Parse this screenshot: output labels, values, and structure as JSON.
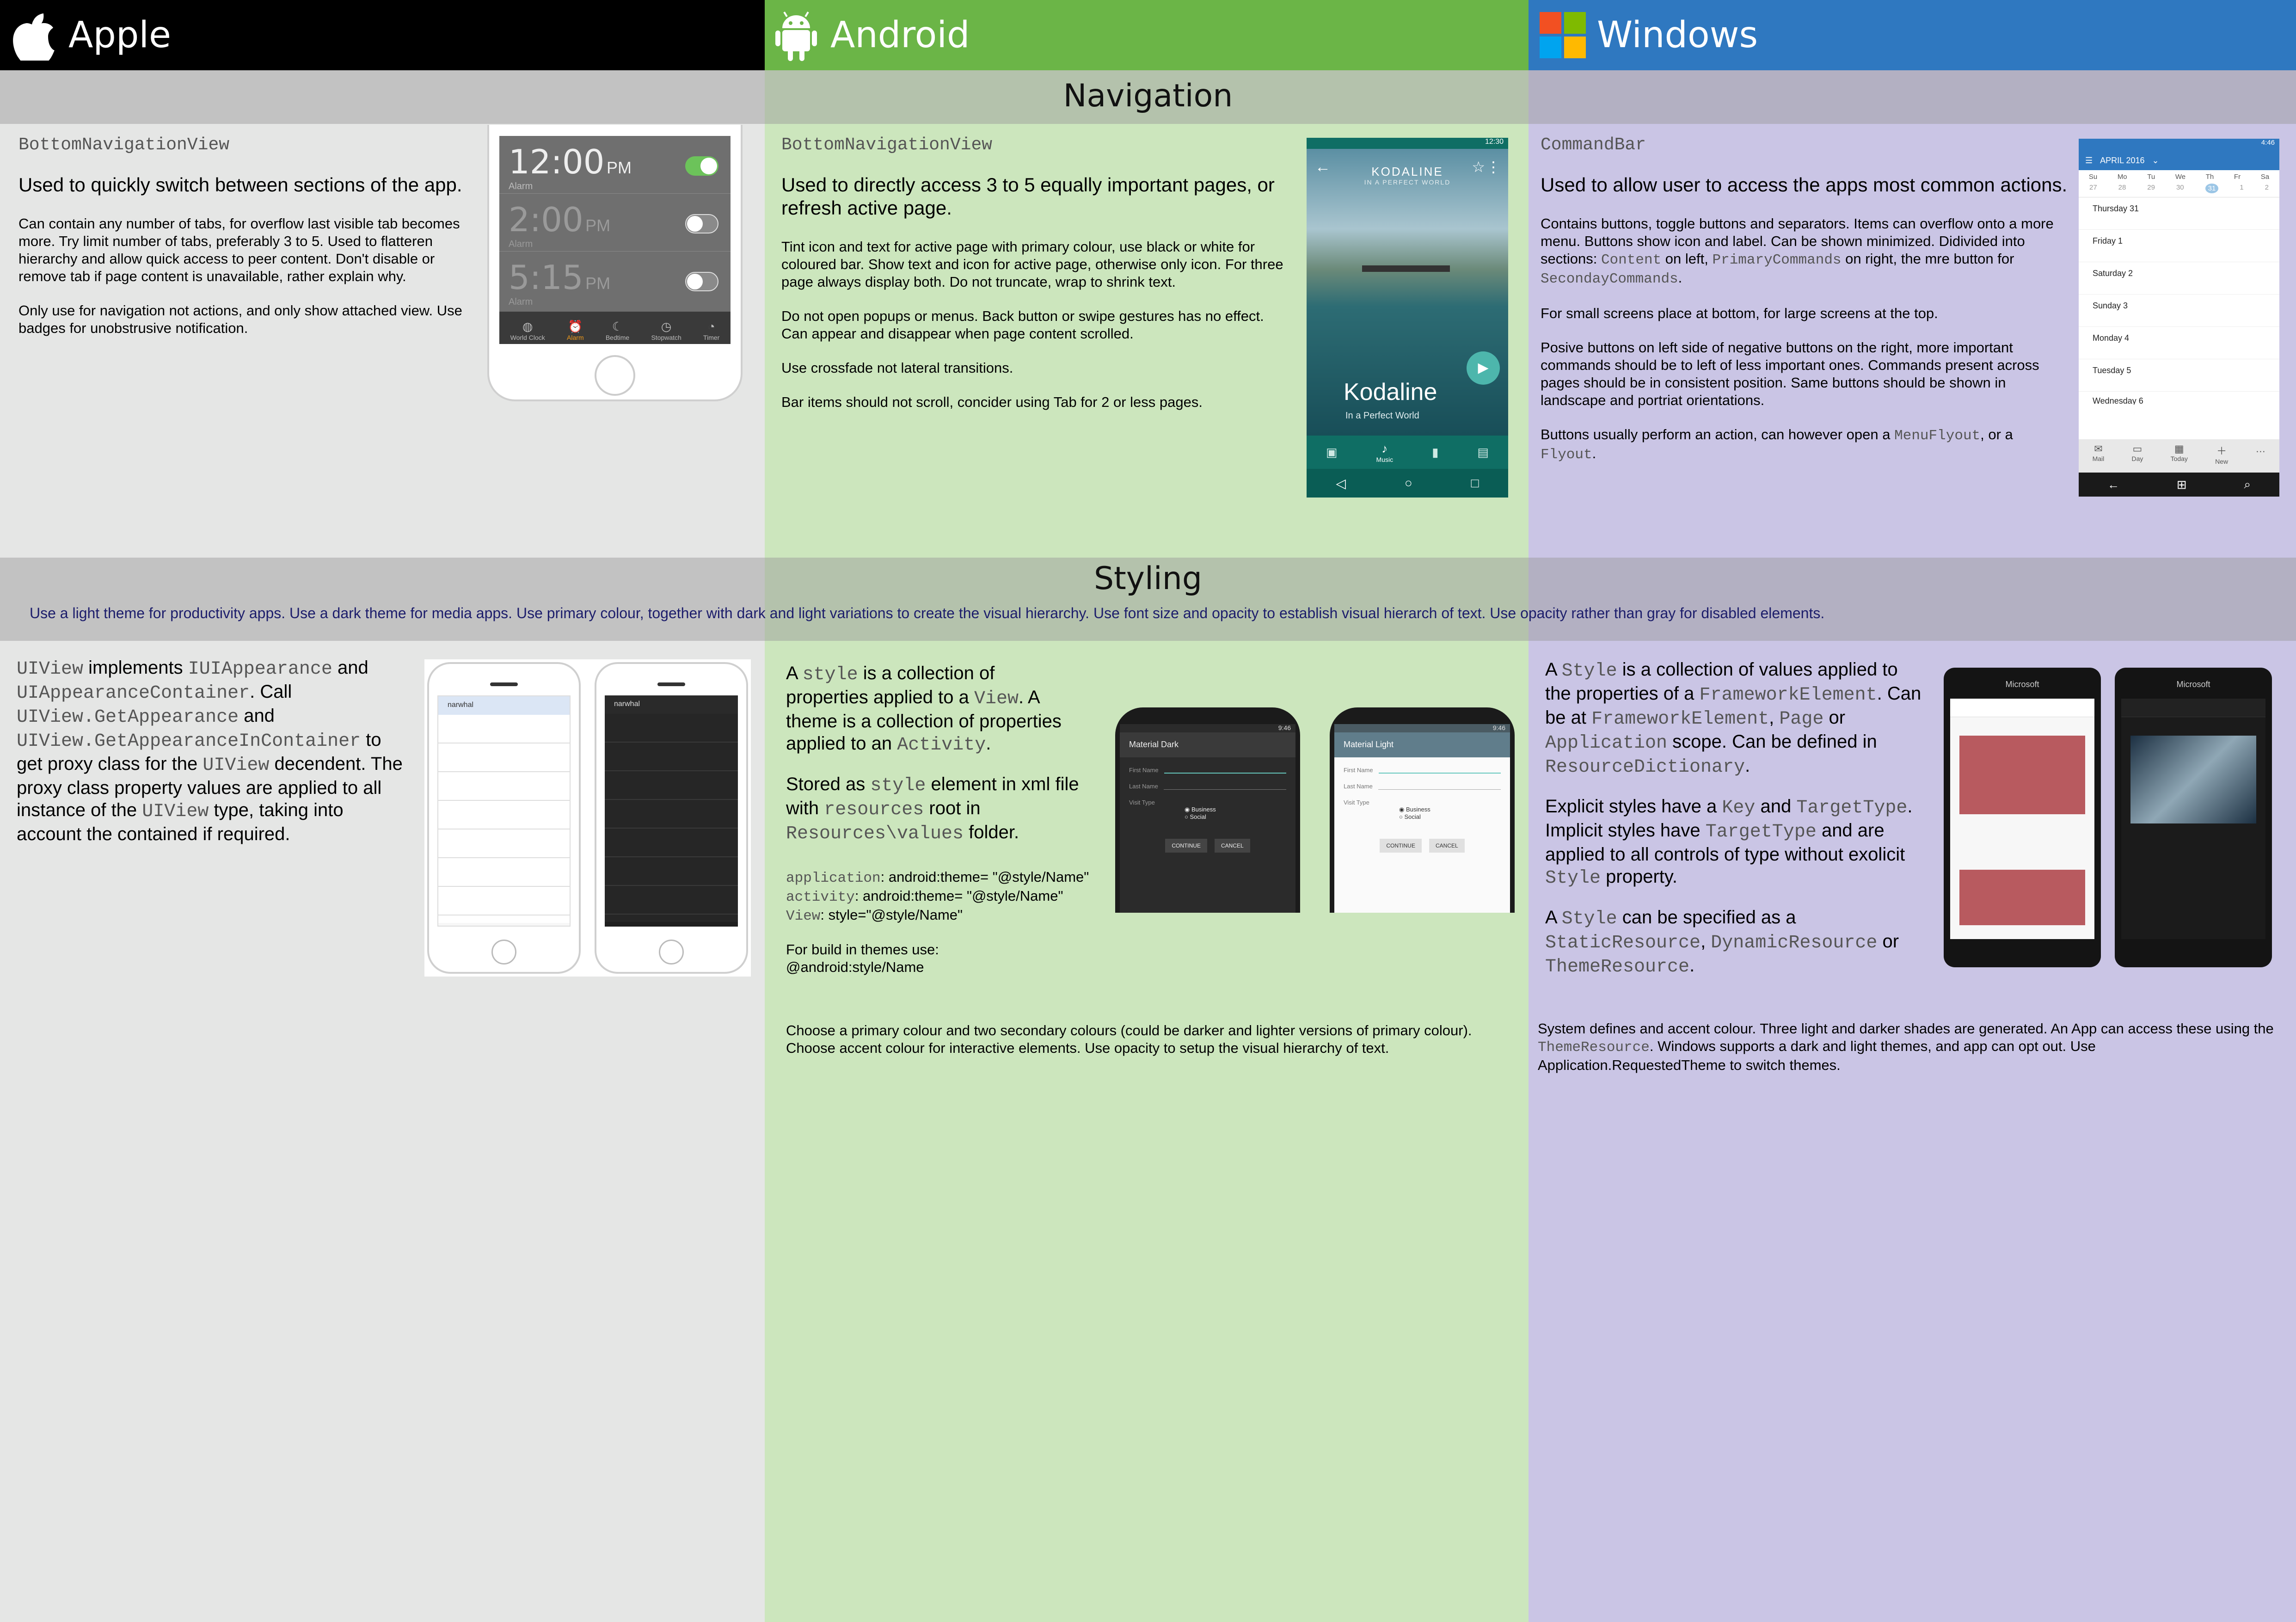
{
  "columns": {
    "apple": {
      "title": "Apple",
      "color": "#000000"
    },
    "android": {
      "title": "Android",
      "color": "#6bb547"
    },
    "windows": {
      "title": "Windows",
      "color": "#2f78c0"
    }
  },
  "sections": {
    "navigation": {
      "title": "Navigation"
    },
    "styling": {
      "title": "Styling",
      "subtitle": "Use a light theme for productivity apps. Use a dark theme for media apps. Use primary colour, together with dark and light variations to create the visual hierarchy. Use font size and opacity to establish visual hierarch of text. Use opacity rather than gray for disabled elements."
    }
  },
  "nav": {
    "apple": {
      "component": "BottomNavigationView",
      "lead": "Used to quickly switch between sections of the app.",
      "p1": "Can contain any number of tabs, for overflow last visible tab becomes more. Try limit number of tabs, preferably 3 to 5. Used to flatteren hierarchy and allow quick access to peer content. Don't disable or remove tab if page content is unavailable, rather explain why.",
      "p2": "Only use for navigation not actions, and only show attached view. Use badges for unobstrusive notification.",
      "phone": {
        "alarms": [
          {
            "time": "12:00",
            "ampm": "PM",
            "label": "Alarm"
          },
          {
            "time": "2:00",
            "ampm": "PM",
            "label": "Alarm"
          },
          {
            "time": "5:15",
            "ampm": "PM",
            "label": "Alarm"
          }
        ],
        "tabs": [
          "World Clock",
          "Alarm",
          "Bedtime",
          "Stopwatch",
          "Timer"
        ]
      }
    },
    "android": {
      "component": "BottomNavigationView",
      "lead": "Used to directly access 3 to 5 equally important pages, or refresh active page.",
      "p1": "Tint icon and text for active page with primary colour, use black or white for coloured bar. Show text and icon for active page, otherwise only icon. For three page always display both. Do not truncate, wrap to shrink text.",
      "p2": "Do not open popups or menus. Back button or swipe gestures has no effect. Can appear and disappear when page content scrolled.",
      "p3": "Use crossfade not lateral transitions.",
      "p4": "Bar items should not scroll, concider using Tab for 2 or less pages.",
      "phone": {
        "status_time": "12:30",
        "album": "KODALINE",
        "album_sub": "IN A PERFECT WORLD",
        "title": "Kodaline",
        "subtitle": "In a Perfect World",
        "active_tab": "Music"
      }
    },
    "windows": {
      "component": "CommandBar",
      "lead": "Used to allow user to access the apps most common actions.",
      "p1a": "Contains buttons, toggle buttons and separators. Items can overflow onto a more menu. Buttons show icon and label. Can be shown minimized. Didivided into sections: ",
      "p1_code1": "Content",
      "p1b": " on left, ",
      "p1_code2": "PrimaryCommands",
      "p1c": " on right, the mre button for ",
      "p1_code3": "SecondayCommands",
      "p1d": ".",
      "p2": "For small screens place at bottom, for large screens at the top.",
      "p3": "Posive buttons on left side of negative buttons on the right, more important commands should be to left of less important ones. Commands present across pages should be in consistent position. Same buttons should be shown in landscape and portriat orientations.",
      "p4a": "Buttons usually perform an action, can however open a ",
      "p4_code1": "MenuFlyout",
      "p4b": ", or a ",
      "p4_code2": "Flyout",
      "p4c": ".",
      "phone": {
        "status_time": "4:46",
        "month": "APRIL 2016",
        "weekdays": [
          "Su",
          "Mo",
          "Tu",
          "We",
          "Th",
          "Fr",
          "Sa"
        ],
        "dates": [
          "27",
          "28",
          "29",
          "30",
          "31",
          "1",
          "2"
        ],
        "days": [
          "Thursday 31",
          "Friday 1",
          "Saturday 2",
          "Sunday 3",
          "Monday 4",
          "Tuesday 5",
          "Wednesday 6"
        ],
        "commands": [
          "Mail",
          "Day",
          "Today",
          "New"
        ]
      }
    }
  },
  "style": {
    "apple": {
      "c1": "UIView",
      "t1": " implements ",
      "c2": "IUIAppearance",
      "t2": " and ",
      "c3": "UIAppearanceContainer",
      "t3": ". Call ",
      "c4": "UIView.GetAppearance",
      "t4": " and ",
      "c5": "UIView.GetAppearanceInContainer",
      "t5": " to get proxy class for the ",
      "c6": "UIView",
      "t6": " decendent. The proxy class property values are applied to all instance of the ",
      "c7": "UIView",
      "t7": " type, taking into account the contained if required.",
      "phone": {
        "app": "narwhal"
      }
    },
    "android": {
      "a1": "A ",
      "a1c": "style",
      "a2": " is a collection of properties applied to a ",
      "a2c": "View",
      "a3": ". A theme is a collection of properties applied to an ",
      "a3c": "Activity",
      "a4": ".",
      "b1": "Stored as ",
      "b1c": "style",
      "b2": " element in xml file with ",
      "b2c": "resources",
      "b3": " root in ",
      "b3c": "Resources\\values",
      "b4": " folder.",
      "code_app": "application",
      "code_app_val": ": android:theme= \"@style/Name\"",
      "code_act": "activity",
      "code_act_val": ": android:theme= \"@style/Name\"",
      "code_view": "View",
      "code_view_val": ": style=\"@style/Name\"",
      "build1": "For build in themes use:",
      "build2": "@android:style/Name",
      "choose": "Choose a primary colour and two secondary colours (could be darker and lighter versions of primary colour). Choose accent colour for interactive elements. Use opacity to setup the visual hierarchy of text.",
      "demo_dark": {
        "title": "Material Dark",
        "time": "9:46",
        "first": "First Name",
        "last": "Last Name",
        "visit": "Visit Type",
        "opt1": "Business",
        "opt2": "Social",
        "btn1": "CONTINUE",
        "btn2": "CANCEL"
      },
      "demo_light": {
        "title": "Material Light",
        "time": "9:46",
        "first": "First Name",
        "last": "Last Name",
        "visit": "Visit Type",
        "opt1": "Business",
        "opt2": "Social",
        "btn1": "CONTINUE",
        "btn2": "CANCEL"
      }
    },
    "windows": {
      "a1": "A ",
      "a1c": "Style",
      "a2": " is a collection of values applied to the properties of a ",
      "a2c": "FrameworkElement",
      "a3": ". Can be at ",
      "a3c": "FrameworkElement",
      "a4": ", ",
      "a4c": "Page",
      "a5": " or ",
      "a5c": "Application",
      "a6": " scope. Can be defined in ",
      "a6c": "ResourceDictionary",
      "a7": ".",
      "b1": "Explicit styles have a ",
      "b1c": "Key",
      "b2": " and ",
      "b2c": "TargetType",
      "b3": ". Implicit styles have ",
      "b3c": "TargetType",
      "b4": " and are applied to all controls of type without exolicit ",
      "b4c": "Style",
      "b5": " property.",
      "c1": "A ",
      "c1c": "Style",
      "c2": " can be specified as a ",
      "c2c": "StaticResource",
      "c3": ", ",
      "c3c": "DynamicResource",
      "c4": " or ",
      "c4c": "ThemeResource",
      "c5": ".",
      "accent1": "System defines and accent colour. Three light and darker shades are generated. An App can access these using the ",
      "accent_code": "ThemeResource",
      "accent2": ". Windows supports a dark and light themes, and app can opt out. Use Application.RequestedTheme to switch themes.",
      "phone_brand": "Microsoft"
    }
  }
}
